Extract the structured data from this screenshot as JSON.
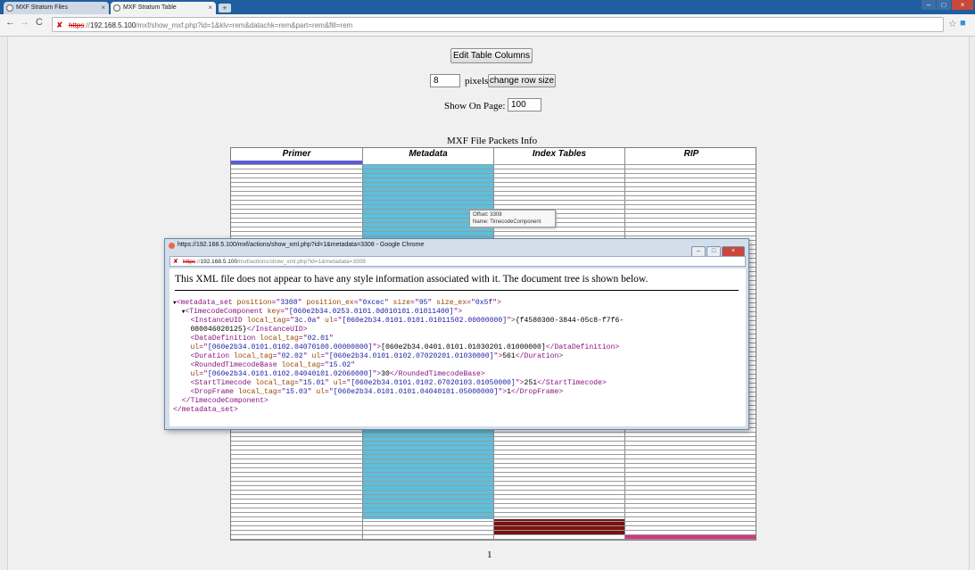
{
  "tabs": [
    {
      "title": "MXF Stratum Files"
    },
    {
      "title": "MXF Stratum Table"
    }
  ],
  "address_bar": {
    "scheme": "https",
    "host": "192.168.5.100",
    "path": "/mxf/show_mxf.php?id=1&klv=rem&datachk=rem&part=rem&fill=rem"
  },
  "page": {
    "edit_columns_button": "Edit Table Columns",
    "row_size_value": "8",
    "pixels_label": "pixels",
    "change_row_size_button": "change row size",
    "show_on_page_label": "Show On Page:",
    "show_on_page_value": "100",
    "table_title": "MXF File Packets Info",
    "columns": [
      "Primer",
      "Metadata",
      "Index Tables",
      "RIP"
    ],
    "page_number": "1"
  },
  "colors": {
    "primer": "#5b5bd6",
    "metadata": "#5bc0de",
    "index_tables": "#7a1212",
    "rip": "#d63384"
  },
  "tooltip": {
    "offset": "Offset: 3308",
    "name": "Name: TimecodeComponent"
  },
  "popup": {
    "window_title": "https://192.168.5.100/mxf/actions/show_xml.php?id=1&metadata=3308 - Google Chrome",
    "url_scheme": "https",
    "url_host": "192.168.5.100",
    "url_path": "/mxf/actions/show_xml.php?id=1&metadata=3308",
    "notice": "This XML file does not appear to have any style information associated with it. The document tree is shown below."
  },
  "xml": {
    "root_tag": "metadata_set",
    "root_position": "3308",
    "root_position_ex": "0xcec",
    "root_size": "95",
    "root_size_ex": "0x5f",
    "component_tag": "TimecodeComponent",
    "component_key": "[060e2b34.0253.0101.0d010101.01011400]",
    "instance_tag": "InstanceUID",
    "instance_local": "3c.0a",
    "instance_ul": "[060e2b34.0101.0101.01011502.00000000]",
    "instance_value_1": "{f4580300-3844-05c8-f7f6-",
    "instance_value_2": "080046020125}",
    "datadef_tag": "DataDefinition",
    "datadef_local": "02.01",
    "datadef_ul": "[060e2b34.0101.0102.04070100.00000000]",
    "datadef_value": "[060e2b34.0401.0101.01030201.01000000]",
    "duration_tag": "Duration",
    "duration_local": "02.02",
    "duration_ul": "[060e2b34.0101.0102.07020201.01030000]",
    "duration_value": "561",
    "rounded_tag": "RoundedTimecodeBase",
    "rounded_local": "15.02",
    "rounded_ul": "[060e2b34.0101.0102.04040101.02060000]",
    "rounded_value": "30",
    "start_tag": "StartTimecode",
    "start_local": "15.01",
    "start_ul": "[060e2b34.0101.0102.07020103.01050000]",
    "start_value": "251",
    "drop_tag": "DropFrame",
    "drop_local": "15.03",
    "drop_ul": "[060e2b34.0101.0101.04040101.05000000]",
    "drop_value": "1"
  }
}
